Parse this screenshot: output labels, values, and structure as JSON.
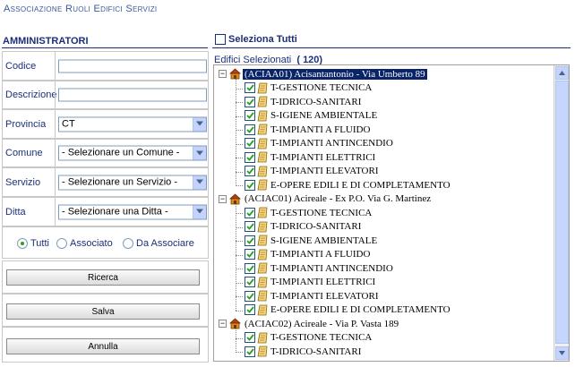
{
  "page": {
    "title": "Associazione Ruoli Edifici Servizi"
  },
  "admin": {
    "title": "AMMINISTRATORI",
    "codice_label": "Codice",
    "codice_value": "",
    "descrizione_label": "Descrizione",
    "descrizione_value": "",
    "provincia_label": "Provincia",
    "provincia_value": "CT",
    "comune_label": "Comune",
    "comune_value": "- Selezionare un Comune -",
    "servizio_label": "Servizio",
    "servizio_value": "- Selezionare un Servizio -",
    "ditta_label": "Ditta",
    "ditta_value": "- Selezionare una Ditta -",
    "radio_tutti": "Tutti",
    "radio_associato": "Associato",
    "radio_da_associare": "Da Associare",
    "radio_selected": "Tutti",
    "ricerca_label": "Ricerca",
    "salva_label": "Salva",
    "annulla_label": "Annulla"
  },
  "select_all": {
    "label": "Seleziona Tutti",
    "checked": false
  },
  "tree": {
    "selected_label": "Edifici Selezionati",
    "selected_count": "( 120)",
    "buildings": [
      {
        "label": "(ACIAA01) Acisantantonio - Via Umberto 89",
        "selected": true,
        "services": [
          "T-GESTIONE TECNICA",
          "T-IDRICO-SANITARI",
          "S-IGIENE AMBIENTALE",
          "T-IMPIANTI A FLUIDO",
          "T-IMPIANTI ANTINCENDIO",
          "T-IMPIANTI ELETTRICI",
          "T-IMPIANTI ELEVATORI",
          "E-OPERE EDILI E DI COMPLETAMENTO"
        ]
      },
      {
        "label": "(ACIAC01) Acireale - Ex P.O. Via G. Martinez",
        "selected": false,
        "services": [
          "T-GESTIONE TECNICA",
          "T-IDRICO-SANITARI",
          "S-IGIENE AMBIENTALE",
          "T-IMPIANTI A FLUIDO",
          "T-IMPIANTI ANTINCENDIO",
          "T-IMPIANTI ELETTRICI",
          "T-IMPIANTI ELEVATORI",
          "E-OPERE EDILI E DI COMPLETAMENTO"
        ]
      },
      {
        "label": "(ACIAC02) Acireale - Via P. Vasta 189",
        "selected": false,
        "services": [
          "T-GESTIONE TECNICA",
          "T-IDRICO-SANITARI"
        ]
      }
    ]
  },
  "colors": {
    "label_blue": "#1c2f78",
    "selection_bg": "#0a246a",
    "scrollbar": "#c3d3fd",
    "check_green": "#21a121"
  }
}
